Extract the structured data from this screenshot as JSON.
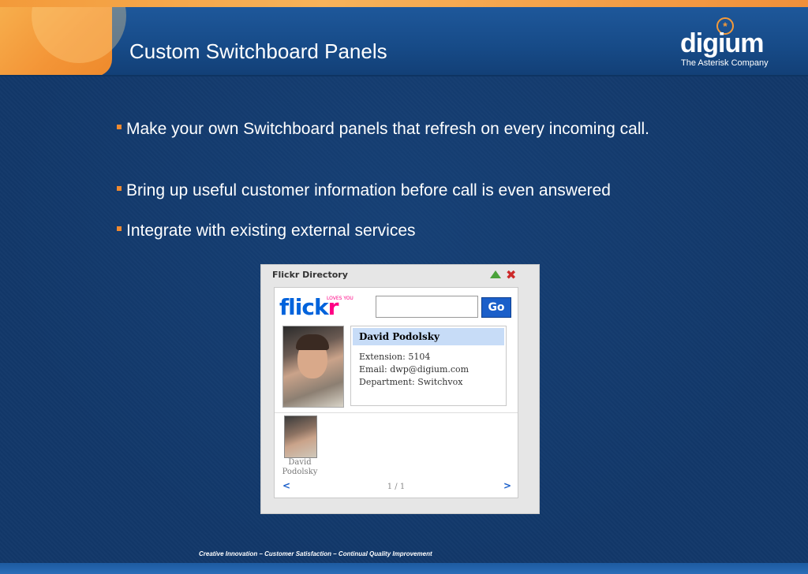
{
  "slide": {
    "title": "Custom Switchboard Panels",
    "logo_word": "digium",
    "logo_tagline": "The Asterisk Company",
    "bullets": [
      "Make your own Switchboard panels that refresh on every incoming call.",
      "Bring up useful customer information before call is even answered",
      "Integrate with existing external services"
    ],
    "footer": "Creative Innovation – Customer Satisfaction – Continual Quality Improvement"
  },
  "widget": {
    "title": "Flickr Directory",
    "flickr_logo_a": "flick",
    "flickr_logo_b": "r",
    "loves_you": "LOVES YOU",
    "search_value": "",
    "go_label": "Go",
    "contact": {
      "name": "David Podolsky",
      "extension": "Extension: 5104",
      "email": "Email: dwp@digium.com",
      "department": "Department: Switchvox"
    },
    "thumb_label_first": "David",
    "thumb_label_last": "Podolsky",
    "prev_label": "<",
    "next_label": ">",
    "pager": "1 / 1"
  },
  "colors": {
    "background": "#12386a",
    "accent_orange": "#f39a3a",
    "flickr_blue": "#0063dc",
    "flickr_pink": "#ff0084",
    "go_button": "#1b5fc9"
  }
}
